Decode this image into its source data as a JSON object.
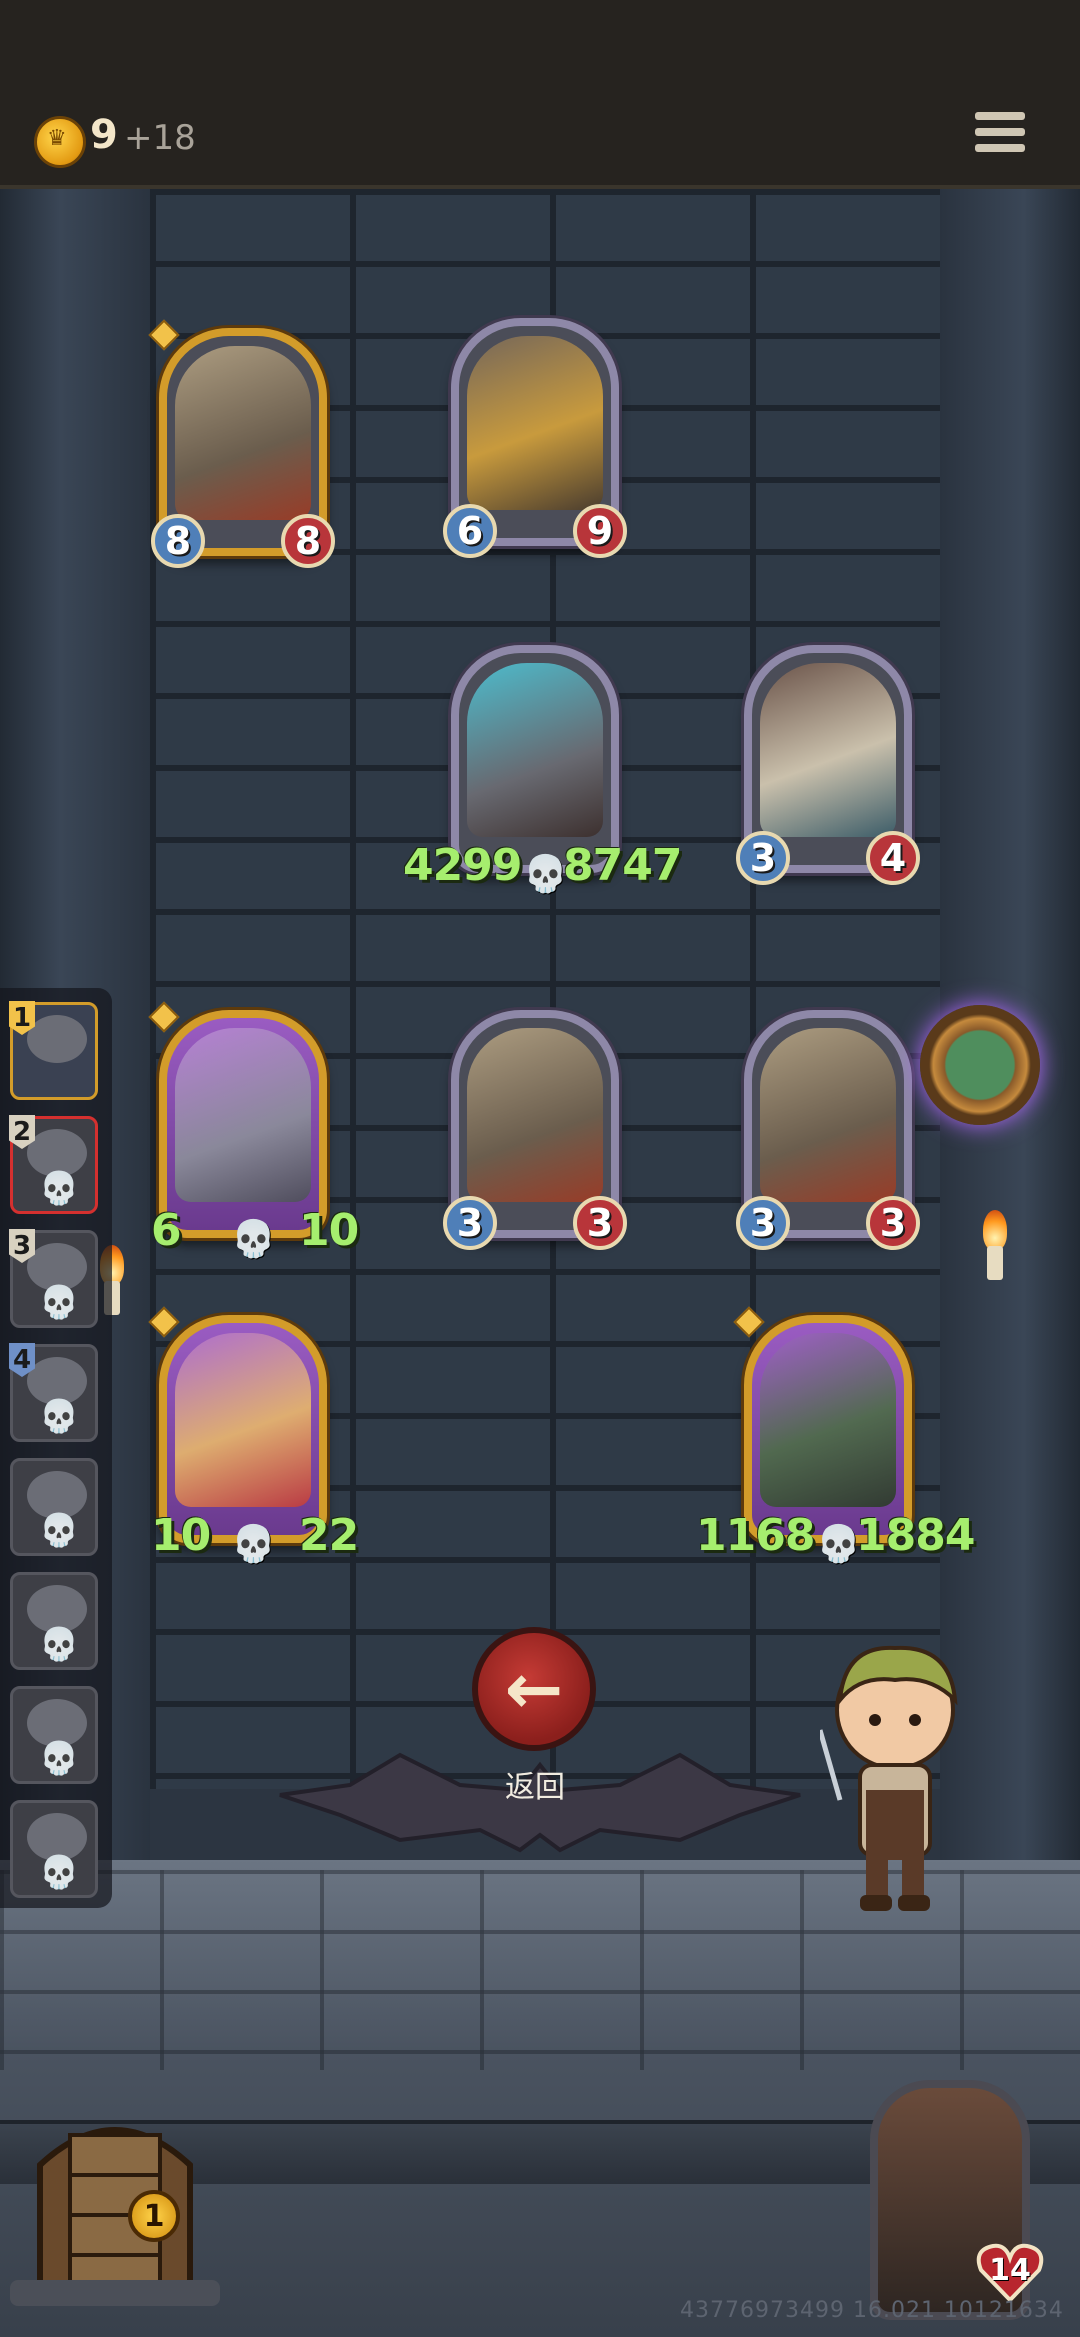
{
  "top_bar": {
    "gold": "9",
    "gold_income": "+18",
    "menu_icon": "hamburger-menu-icon"
  },
  "board": {
    "cards": [
      {
        "id": "card-zeppelin-gold",
        "attack": "8",
        "health": "8",
        "frame": "gold",
        "icon": "zeppelin-bomb"
      },
      {
        "id": "card-dragon",
        "attack": "6",
        "health": "9",
        "frame": "silver",
        "icon": "golden-dragon"
      },
      {
        "id": "card-demon-boss",
        "attack": "4299",
        "health": "8747",
        "frame": "silver",
        "icon": "horned-demon",
        "dead": true
      },
      {
        "id": "card-beast",
        "attack": "3",
        "health": "4",
        "frame": "silver",
        "icon": "white-beast"
      },
      {
        "id": "card-robot",
        "attack": "6",
        "health": "10",
        "frame": "gold",
        "icon": "tin-robot",
        "dead": true
      },
      {
        "id": "card-zeppelin-a",
        "attack": "3",
        "health": "3",
        "frame": "silver",
        "icon": "zeppelin-bomb"
      },
      {
        "id": "card-zeppelin-b",
        "attack": "3",
        "health": "3",
        "frame": "silver",
        "icon": "zeppelin-bomb"
      },
      {
        "id": "card-pinocchio",
        "attack": "10",
        "health": "22",
        "frame": "gold",
        "icon": "pinocchio",
        "dead": true
      },
      {
        "id": "card-grinning-monster",
        "attack": "1168",
        "health": "1884",
        "frame": "gold",
        "icon": "grinning-monster",
        "dead": true
      }
    ]
  },
  "queue": {
    "slots": [
      {
        "num": "1",
        "state": "active",
        "icon": "cat-portrait"
      },
      {
        "num": "2",
        "state": "selected",
        "icon": "girl-portrait",
        "dead": true
      },
      {
        "num": "3",
        "state": "",
        "icon": "ogre-portrait",
        "dead": true
      },
      {
        "num": "4",
        "state": "",
        "icon": "knight-portrait",
        "dead": true
      },
      {
        "num": "",
        "state": "",
        "icon": "witch-portrait",
        "dead": true
      },
      {
        "num": "",
        "state": "",
        "icon": "wolf-portrait",
        "dead": true
      },
      {
        "num": "",
        "state": "",
        "icon": "lady-portrait",
        "dead": true
      },
      {
        "num": "",
        "state": "",
        "icon": "elf-portrait",
        "dead": true
      }
    ]
  },
  "back_button": {
    "label": "返回",
    "icon": "arrow-left-icon"
  },
  "chest": {
    "count": "1"
  },
  "player_portrait": {
    "health": "14",
    "icon": "cat-hero-portrait"
  },
  "footer": {
    "id_text": "43776973499 16.021 10121634"
  },
  "colors": {
    "gold_frame": "#d39c2a",
    "silver_frame": "#8e88a8",
    "attack": "#4f7fb8",
    "health": "#b8353a",
    "buff_text": "#a6ee6e"
  }
}
